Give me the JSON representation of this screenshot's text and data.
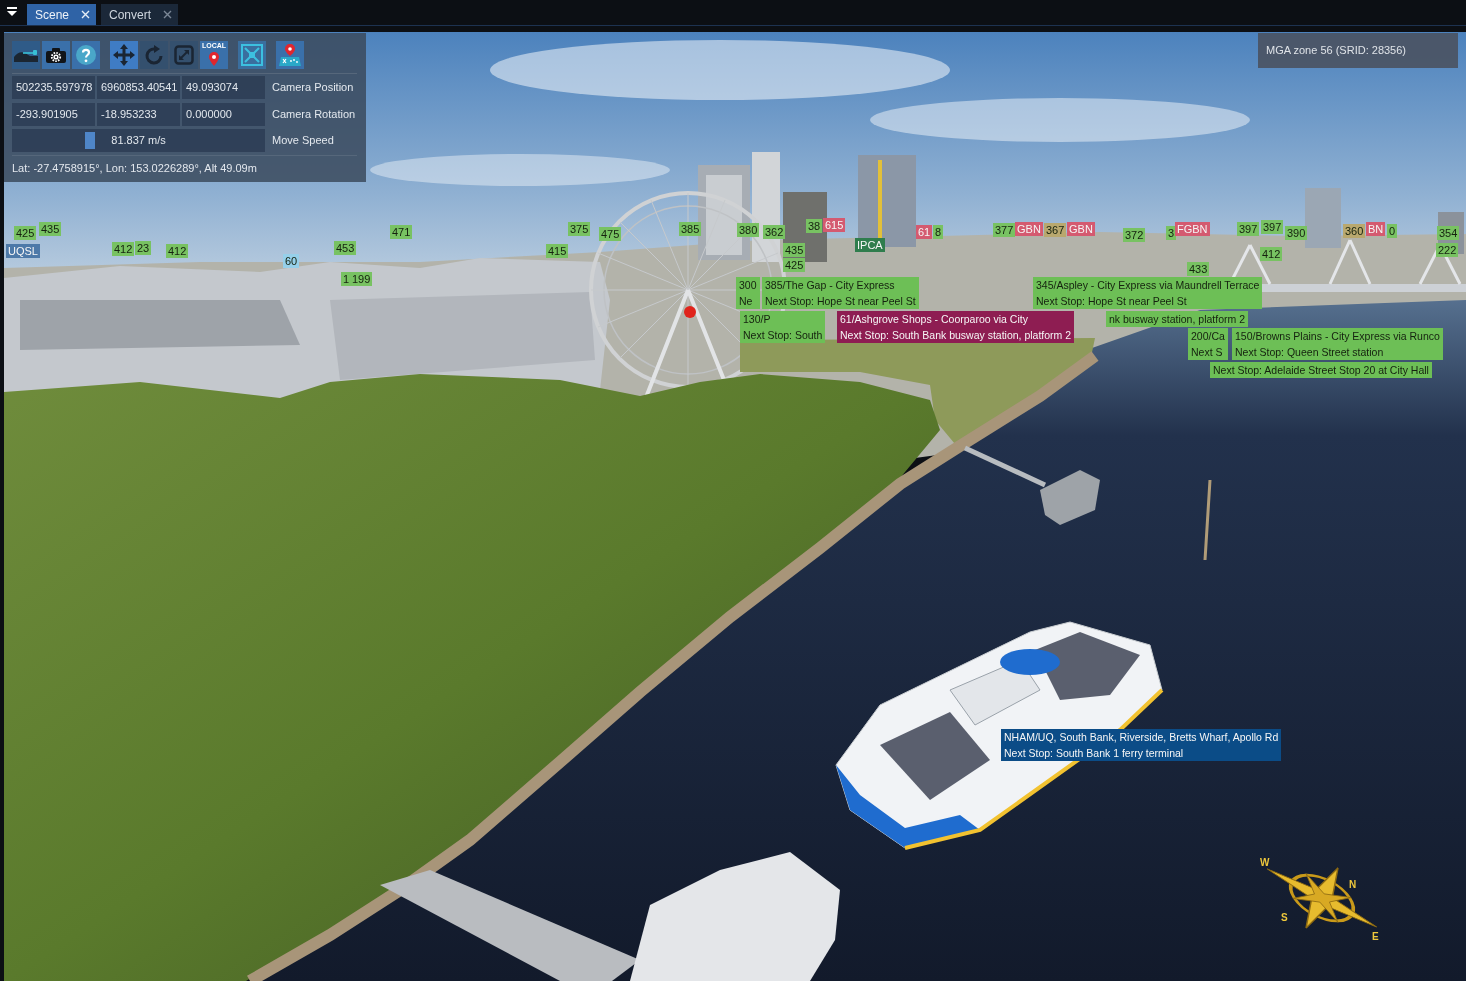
{
  "tabs": [
    {
      "label": "Scene",
      "selected": true
    },
    {
      "label": "Convert",
      "selected": false
    }
  ],
  "toolbar": {
    "gizmo_modes": [
      {
        "selected": true
      },
      {
        "selected": false
      },
      {
        "selected": false
      }
    ],
    "space_toggle": {
      "label": "LOCAL"
    }
  },
  "camera": {
    "rows": [
      {
        "kind": "vector",
        "values": [
          "502235.597978",
          "6960853.40541",
          "49.093074"
        ],
        "label": "Camera Position"
      },
      {
        "kind": "vector",
        "values": [
          "-293.901905",
          "-18.953233",
          "0.000000"
        ],
        "label": "Camera Rotation"
      },
      {
        "kind": "slider",
        "level": 0.3,
        "reading": "81.837 m/s",
        "label": "Move Speed"
      }
    ],
    "geo": "Lat: -27.4758915°, Lon: 153.0226289°, Alt 49.09m"
  },
  "projection": "MGA zone 56 (SRID: 28356)",
  "labels": [
    {
      "kind": "tag",
      "lines": [
        "435"
      ],
      "color": "#78c262"
    },
    {
      "kind": "tag",
      "lines": [
        "425"
      ],
      "color": "#78c262"
    },
    {
      "kind": "tag",
      "lines": [
        "471"
      ],
      "color": "#78c262"
    },
    {
      "kind": "tag",
      "lines": [
        "375"
      ],
      "color": "#78c262"
    },
    {
      "kind": "tag",
      "lines": [
        "475"
      ],
      "color": "#78c262"
    },
    {
      "kind": "tag",
      "lines": [
        "385"
      ],
      "color": "#78c262"
    },
    {
      "kind": "tag",
      "lines": [
        "380"
      ],
      "color": "#78c262"
    },
    {
      "kind": "tag",
      "lines": [
        "362"
      ],
      "color": "#78c262"
    },
    {
      "kind": "tag",
      "lines": [
        "38"
      ],
      "color": "#78c262"
    },
    {
      "kind": "tag",
      "lines": [
        "615"
      ],
      "color": "#d45a70"
    },
    {
      "kind": "tag",
      "lines": [
        "61"
      ],
      "color": "#d45a70"
    },
    {
      "kind": "tag",
      "lines": [
        "8"
      ],
      "color": "#78c262"
    },
    {
      "kind": "tag",
      "lines": [
        "377"
      ],
      "color": "#78c262"
    },
    {
      "kind": "tag",
      "lines": [
        "GBN"
      ],
      "color": "#d45a70"
    },
    {
      "kind": "tag",
      "lines": [
        "367"
      ],
      "color": "#b9a86e"
    },
    {
      "kind": "tag",
      "lines": [
        "GBN"
      ],
      "color": "#d45a70"
    },
    {
      "kind": "tag",
      "lines": [
        "372"
      ],
      "color": "#78c262"
    },
    {
      "kind": "tag",
      "lines": [
        "3"
      ],
      "color": "#78c262"
    },
    {
      "kind": "tag",
      "lines": [
        "FGBN"
      ],
      "color": "#d45a70"
    },
    {
      "kind": "tag",
      "lines": [
        "397"
      ],
      "color": "#78c262"
    },
    {
      "kind": "tag",
      "lines": [
        "397"
      ],
      "color": "#78c262"
    },
    {
      "kind": "tag",
      "lines": [
        "390"
      ],
      "color": "#78c262"
    },
    {
      "kind": "tag",
      "lines": [
        "360"
      ],
      "color": "#b9a86e"
    },
    {
      "kind": "tag",
      "lines": [
        "BN"
      ],
      "color": "#d45a70"
    },
    {
      "kind": "tag",
      "lines": [
        "0"
      ],
      "color": "#78c262"
    },
    {
      "kind": "tag",
      "lines": [
        "354"
      ],
      "color": "#78c262"
    },
    {
      "kind": "tag",
      "lines": [
        "UQSL"
      ],
      "color": "#4d79a8"
    },
    {
      "kind": "tag",
      "lines": [
        "412"
      ],
      "color": "#78c262"
    },
    {
      "kind": "tag",
      "lines": [
        "23"
      ],
      "color": "#78c262"
    },
    {
      "kind": "tag",
      "lines": [
        "412"
      ],
      "color": "#78c262"
    },
    {
      "kind": "tag",
      "lines": [
        "453"
      ],
      "color": "#78c262"
    },
    {
      "kind": "tag",
      "lines": [
        "415"
      ],
      "color": "#78c262"
    },
    {
      "kind": "tag",
      "lines": [
        "435"
      ],
      "color": "#78c262"
    },
    {
      "kind": "tag",
      "lines": [
        "IPCA"
      ],
      "color": "#2f7d4d"
    },
    {
      "kind": "tag",
      "lines": [
        "222"
      ],
      "color": "#78c262"
    },
    {
      "kind": "tag",
      "lines": [
        "412"
      ],
      "color": "#78c262"
    },
    {
      "kind": "tag",
      "lines": [
        "60"
      ],
      "color": "#96d0ea"
    },
    {
      "kind": "tag",
      "lines": [
        "425"
      ],
      "color": "#78c262"
    },
    {
      "kind": "tag",
      "lines": [
        "433"
      ],
      "color": "#78c262"
    },
    {
      "kind": "tag",
      "lines": [
        "1"
      ],
      "color": "#78c262"
    },
    {
      "kind": "tag",
      "lines": [
        "199"
      ],
      "color": "#78c262"
    },
    {
      "kind": "route",
      "lines": [
        "300",
        "Ne"
      ],
      "color": "#6dbf56"
    },
    {
      "kind": "route",
      "lines": [
        "385/The Gap - City Express",
        "Next Stop: Hope St near Peel St"
      ],
      "color": "#6dbf56"
    },
    {
      "kind": "route",
      "lines": [
        "345/Aspley - City Express via Maundrell Terrace",
        "Next Stop: Hope St near Peel St"
      ],
      "color": "#6dbf56"
    },
    {
      "kind": "route",
      "lines": [
        "130/P",
        "Next Stop: South"
      ],
      "color": "#6dbf56"
    },
    {
      "kind": "route",
      "lines": [
        "61/Ashgrove Shops - Coorparoo via City",
        "Next Stop: South Bank busway station, platform 2"
      ],
      "color": "#8e1d52"
    },
    {
      "kind": "route",
      "lines": [
        "nk busway station, platform 2"
      ],
      "color": "#6dbf56"
    },
    {
      "kind": "route",
      "lines": [
        "200/Ca",
        "Next S"
      ],
      "color": "#6dbf56"
    },
    {
      "kind": "route",
      "lines": [
        "150/Browns Plains - City Express via Runco",
        "Next Stop: Queen Street station"
      ],
      "color": "#6dbf56"
    },
    {
      "kind": "route",
      "lines": [
        "Next Stop: Adelaide Street Stop 20 at City Hall"
      ],
      "color": "#6dbf56"
    },
    {
      "kind": "route",
      "lines": [
        "NHAM/UQ, South Bank, Riverside, Bretts Wharf, Apollo Rd",
        "Next Stop: South Bank 1 ferry terminal"
      ],
      "color": "#0b4c87"
    }
  ],
  "compass": {
    "letters": [
      "W",
      "N",
      "S",
      "E"
    ]
  }
}
